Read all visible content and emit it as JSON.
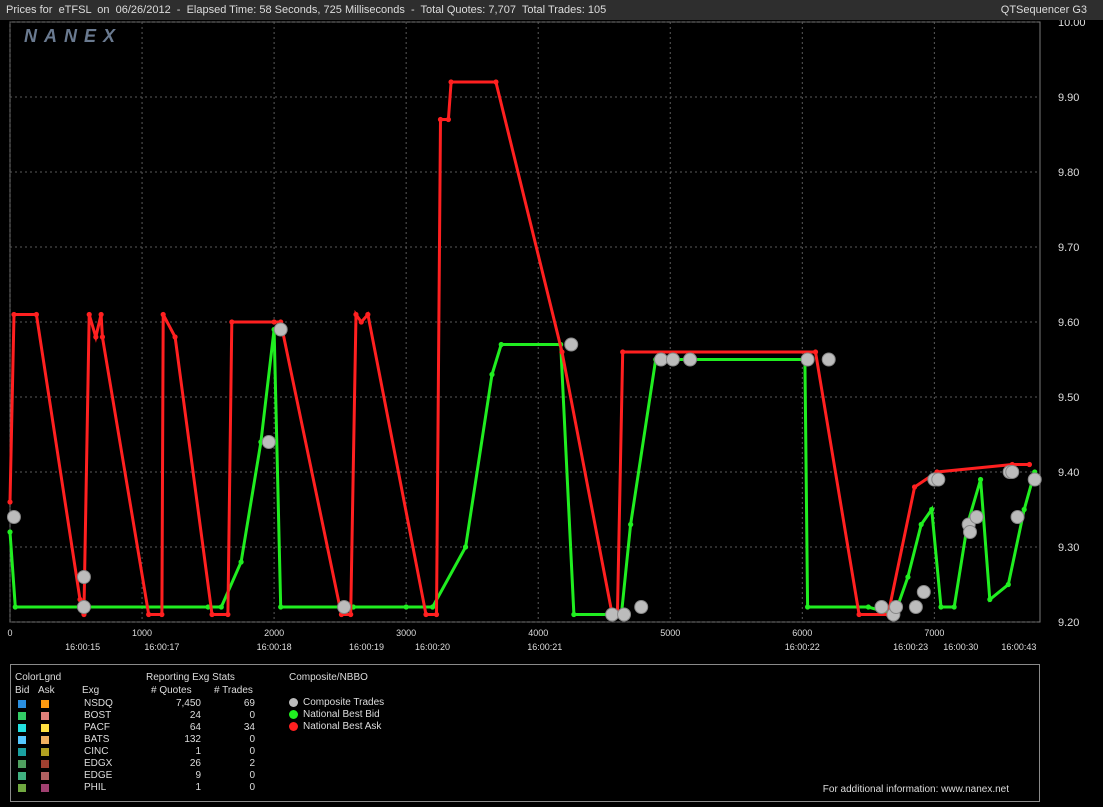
{
  "header": {
    "title": "Prices for  eTFSL  on  06/26/2012  -  Elapsed Time: 58 Seconds, 725 Milliseconds  -  Total Quotes: 7,707  Total Trades: 105",
    "app_name": "QTSequencer G3",
    "logo": "NANEX"
  },
  "chart_data": {
    "type": "line",
    "ylim": [
      9.2,
      10.0
    ],
    "y_ticks": [
      "10.00",
      "9.90",
      "9.80",
      "9.70",
      "9.60",
      "9.50",
      "9.40",
      "9.30",
      "9.20"
    ],
    "x_ticks": [
      0,
      1000,
      2000,
      3000,
      4000,
      5000,
      6000,
      7000
    ],
    "x_index_max": 7800,
    "time_labels": [
      {
        "x": 550,
        "label": "16:00:15"
      },
      {
        "x": 1150,
        "label": "16:00:17"
      },
      {
        "x": 2000,
        "label": "16:00:18"
      },
      {
        "x": 2700,
        "label": "16:00:19"
      },
      {
        "x": 3200,
        "label": "16:00:20"
      },
      {
        "x": 4050,
        "label": "16:00:21"
      },
      {
        "x": 6000,
        "label": "16:00:22"
      },
      {
        "x": 6820,
        "label": "16:00:23"
      },
      {
        "x": 7200,
        "label": "16:00:30"
      },
      {
        "x": 7640,
        "label": "16:00:43"
      }
    ],
    "series": [
      {
        "name": "National Best Ask",
        "color": "#ff2020",
        "points": [
          [
            0,
            9.36
          ],
          [
            30,
            9.61
          ],
          [
            200,
            9.61
          ],
          [
            530,
            9.23
          ],
          [
            560,
            9.21
          ],
          [
            600,
            9.61
          ],
          [
            650,
            9.58
          ],
          [
            690,
            9.61
          ],
          [
            700,
            9.58
          ],
          [
            1050,
            9.21
          ],
          [
            1150,
            9.21
          ],
          [
            1160,
            9.61
          ],
          [
            1250,
            9.58
          ],
          [
            1530,
            9.21
          ],
          [
            1650,
            9.21
          ],
          [
            1680,
            9.6
          ],
          [
            2000,
            9.6
          ],
          [
            2050,
            9.6
          ],
          [
            2510,
            9.21
          ],
          [
            2580,
            9.21
          ],
          [
            2620,
            9.61
          ],
          [
            2660,
            9.6
          ],
          [
            2710,
            9.61
          ],
          [
            3150,
            9.21
          ],
          [
            3230,
            9.21
          ],
          [
            3260,
            9.87
          ],
          [
            3320,
            9.87
          ],
          [
            3340,
            9.92
          ],
          [
            3680,
            9.92
          ],
          [
            4180,
            9.56
          ],
          [
            4560,
            9.21
          ],
          [
            4600,
            9.21
          ],
          [
            4640,
            9.56
          ],
          [
            6100,
            9.56
          ],
          [
            6430,
            9.21
          ],
          [
            6650,
            9.21
          ],
          [
            6850,
            9.38
          ],
          [
            7020,
            9.4
          ],
          [
            7590,
            9.41
          ],
          [
            7720,
            9.41
          ]
        ]
      },
      {
        "name": "National Best Bid",
        "color": "#20ee20",
        "points": [
          [
            0,
            9.32
          ],
          [
            40,
            9.22
          ],
          [
            1500,
            9.22
          ],
          [
            1600,
            9.22
          ],
          [
            1750,
            9.28
          ],
          [
            1900,
            9.44
          ],
          [
            2000,
            9.59
          ],
          [
            2050,
            9.22
          ],
          [
            2530,
            9.22
          ],
          [
            2600,
            9.22
          ],
          [
            3000,
            9.22
          ],
          [
            3200,
            9.22
          ],
          [
            3450,
            9.3
          ],
          [
            3650,
            9.53
          ],
          [
            3720,
            9.57
          ],
          [
            4170,
            9.57
          ],
          [
            4270,
            9.21
          ],
          [
            4630,
            9.21
          ],
          [
            4700,
            9.33
          ],
          [
            4890,
            9.55
          ],
          [
            5000,
            9.55
          ],
          [
            6020,
            9.55
          ],
          [
            6040,
            9.22
          ],
          [
            6500,
            9.22
          ],
          [
            6700,
            9.21
          ],
          [
            6800,
            9.26
          ],
          [
            6900,
            9.33
          ],
          [
            6980,
            9.35
          ],
          [
            7050,
            9.22
          ],
          [
            7150,
            9.22
          ],
          [
            7250,
            9.33
          ],
          [
            7350,
            9.39
          ],
          [
            7420,
            9.23
          ],
          [
            7560,
            9.25
          ],
          [
            7680,
            9.35
          ],
          [
            7760,
            9.4
          ]
        ]
      },
      {
        "name": "Composite Trades",
        "color": "#bcbcbc",
        "points": [
          [
            30,
            9.34
          ],
          [
            560,
            9.26
          ],
          [
            560,
            9.22
          ],
          [
            1960,
            9.44
          ],
          [
            2050,
            9.59
          ],
          [
            2530,
            9.22
          ],
          [
            4250,
            9.57
          ],
          [
            4560,
            9.21
          ],
          [
            4650,
            9.21
          ],
          [
            4780,
            9.22
          ],
          [
            4930,
            9.55
          ],
          [
            5020,
            9.55
          ],
          [
            5150,
            9.55
          ],
          [
            6040,
            9.55
          ],
          [
            6200,
            9.55
          ],
          [
            6600,
            9.22
          ],
          [
            6690,
            9.21
          ],
          [
            6710,
            9.22
          ],
          [
            6860,
            9.22
          ],
          [
            6920,
            9.24
          ],
          [
            7000,
            9.39
          ],
          [
            7030,
            9.39
          ],
          [
            7260,
            9.33
          ],
          [
            7270,
            9.32
          ],
          [
            7320,
            9.34
          ],
          [
            7570,
            9.4
          ],
          [
            7590,
            9.4
          ],
          [
            7630,
            9.34
          ],
          [
            7760,
            9.39
          ]
        ]
      }
    ]
  },
  "legend": {
    "colorlgnd_label": "ColorLgnd",
    "bid_label": "Bid",
    "ask_label": "Ask",
    "exg_label": "Exg",
    "stats_header": "Reporting Exg Stats",
    "quotes_header": "# Quotes",
    "trades_header": "# Trades",
    "composite_header": "Composite/NBBO",
    "exchanges": [
      {
        "name": "NSDQ",
        "quotes": "7,450",
        "trades": "69",
        "bid_color": "#2a8fe0",
        "ask_color": "#ff9a10"
      },
      {
        "name": "BOST",
        "quotes": "24",
        "trades": "0",
        "bid_color": "#33cc66",
        "ask_color": "#e0807a"
      },
      {
        "name": "PACF",
        "quotes": "64",
        "trades": "34",
        "bid_color": "#22e0e0",
        "ask_color": "#ffe040"
      },
      {
        "name": "BATS",
        "quotes": "132",
        "trades": "0",
        "bid_color": "#55c8ff",
        "ask_color": "#f0b060"
      },
      {
        "name": "CINC",
        "quotes": "1",
        "trades": "0",
        "bid_color": "#1aa0a0",
        "ask_color": "#b0a020"
      },
      {
        "name": "EDGX",
        "quotes": "26",
        "trades": "2",
        "bid_color": "#50a060",
        "ask_color": "#a04030"
      },
      {
        "name": "EDGE",
        "quotes": "9",
        "trades": "0",
        "bid_color": "#40b080",
        "ask_color": "#b06060"
      },
      {
        "name": "PHIL",
        "quotes": "1",
        "trades": "0",
        "bid_color": "#70a840",
        "ask_color": "#a04070"
      }
    ],
    "composite_items": [
      {
        "label": "Composite Trades",
        "color": "#bcbcbc"
      },
      {
        "label": "National Best Bid",
        "color": "#20ee20"
      },
      {
        "label": "National Best Ask",
        "color": "#ff2020"
      }
    ]
  },
  "footer": {
    "info": "For additional information: www.nanex.net"
  }
}
